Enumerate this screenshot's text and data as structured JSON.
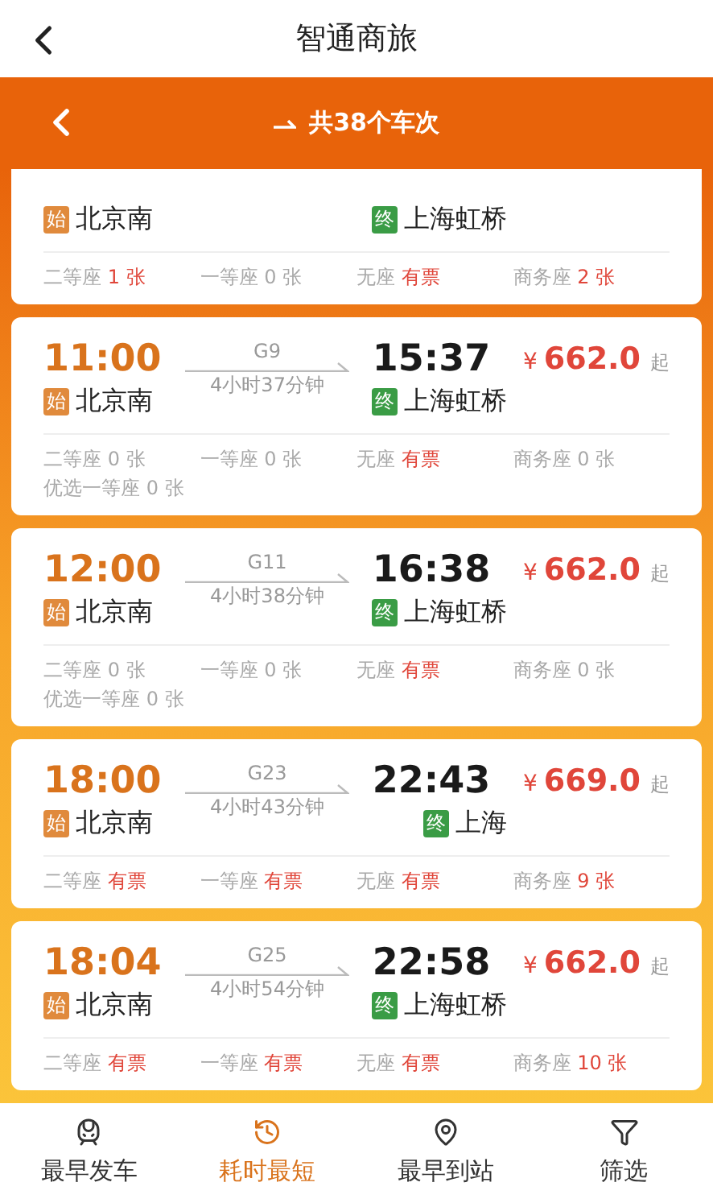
{
  "header": {
    "title": "智通商旅"
  },
  "subheader": {
    "title": "共38个车次"
  },
  "trains": [
    {
      "partial": true,
      "from_badge": "始",
      "from": "北京南",
      "to_badge": "终",
      "to": "上海虹桥",
      "seats": [
        {
          "name": "二等座",
          "count": "1 张",
          "available": true
        },
        {
          "name": "一等座",
          "count": "0 张",
          "available": false
        },
        {
          "name": "无座",
          "count": "有票",
          "available": true
        },
        {
          "name": "商务座",
          "count": "2 张",
          "available": true
        }
      ]
    },
    {
      "depart_time": "11:00",
      "train_no": "G9",
      "duration": "4小时37分钟",
      "arrive_time": "15:37",
      "from_badge": "始",
      "from": "北京南",
      "to_badge": "终",
      "to": "上海虹桥",
      "price_symbol": "¥",
      "price": "662.0",
      "price_suffix": "起",
      "seats": [
        {
          "name": "二等座",
          "count": "0 张",
          "available": false
        },
        {
          "name": "一等座",
          "count": "0 张",
          "available": false
        },
        {
          "name": "无座",
          "count": "有票",
          "available": true
        },
        {
          "name": "商务座",
          "count": "0 张",
          "available": false
        }
      ],
      "extra_seats": [
        {
          "name": "优选一等座",
          "count": "0 张",
          "available": false
        }
      ]
    },
    {
      "depart_time": "12:00",
      "train_no": "G11",
      "duration": "4小时38分钟",
      "arrive_time": "16:38",
      "from_badge": "始",
      "from": "北京南",
      "to_badge": "终",
      "to": "上海虹桥",
      "price_symbol": "¥",
      "price": "662.0",
      "price_suffix": "起",
      "seats": [
        {
          "name": "二等座",
          "count": "0 张",
          "available": false
        },
        {
          "name": "一等座",
          "count": "0 张",
          "available": false
        },
        {
          "name": "无座",
          "count": "有票",
          "available": true
        },
        {
          "name": "商务座",
          "count": "0 张",
          "available": false
        }
      ],
      "extra_seats": [
        {
          "name": "优选一等座",
          "count": "0 张",
          "available": false
        }
      ]
    },
    {
      "depart_time": "18:00",
      "train_no": "G23",
      "duration": "4小时43分钟",
      "arrive_time": "22:43",
      "from_badge": "始",
      "from": "北京南",
      "to_badge": "终",
      "to": "上海",
      "price_symbol": "¥",
      "price": "669.0",
      "price_suffix": "起",
      "seats": [
        {
          "name": "二等座",
          "count": "有票",
          "available": true
        },
        {
          "name": "一等座",
          "count": "有票",
          "available": true
        },
        {
          "name": "无座",
          "count": "有票",
          "available": true
        },
        {
          "name": "商务座",
          "count": "9 张",
          "available": true
        }
      ]
    },
    {
      "depart_time": "18:04",
      "train_no": "G25",
      "duration": "4小时54分钟",
      "arrive_time": "22:58",
      "from_badge": "始",
      "from": "北京南",
      "to_badge": "终",
      "to": "上海虹桥",
      "price_symbol": "¥",
      "price": "662.0",
      "price_suffix": "起",
      "seats": [
        {
          "name": "二等座",
          "count": "有票",
          "available": true
        },
        {
          "name": "一等座",
          "count": "有票",
          "available": true
        },
        {
          "name": "无座",
          "count": "有票",
          "available": true
        },
        {
          "name": "商务座",
          "count": "10 张",
          "available": true
        }
      ]
    }
  ],
  "tabs": [
    {
      "label": "最早发车",
      "kind": "train",
      "selected": false
    },
    {
      "label": "耗时最短",
      "kind": "clock",
      "selected": true
    },
    {
      "label": "最早到站",
      "kind": "pin",
      "selected": false
    },
    {
      "label": "筛选",
      "kind": "filter",
      "selected": false
    }
  ]
}
